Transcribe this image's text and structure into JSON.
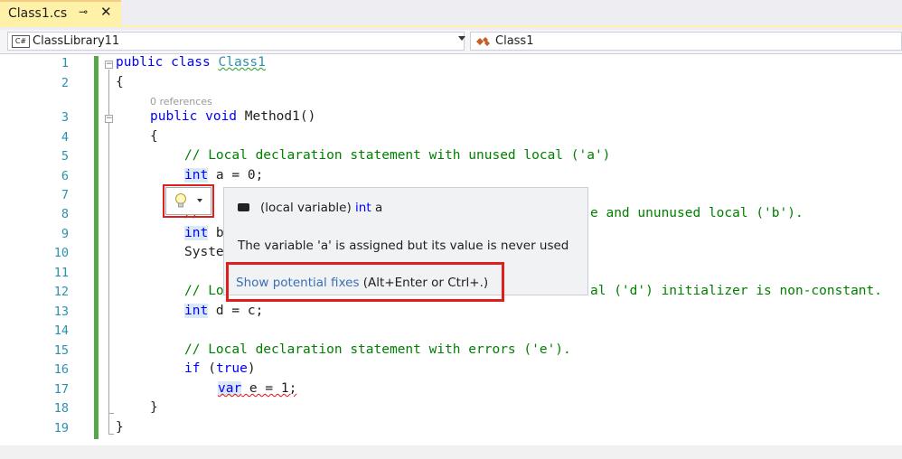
{
  "tab": {
    "title": "Class1.cs",
    "pin_glyph": "⊸",
    "close_glyph": "✕"
  },
  "navbar": {
    "project": "ClassLibrary11",
    "project_icon_text": "C#",
    "class_name": "Class1"
  },
  "gutter": {
    "line_numbers": [
      "1",
      "2",
      "3",
      "4",
      "5",
      "6",
      "7",
      "8",
      "9",
      "10",
      "11",
      "12",
      "13",
      "14",
      "15",
      "16",
      "17",
      "18",
      "19"
    ]
  },
  "codelens": {
    "references": "0 references"
  },
  "code": {
    "l1_kw": "public class ",
    "l1_name": "Class1",
    "l2": "{",
    "l3_kw": "public void ",
    "l3_rest": "Method1()",
    "l4": "{",
    "l5": "// Local declaration statement with unused local ('a')",
    "l6_type": "int",
    "l6_rest": " a = 0;",
    "l8_left": "//",
    "l8_right": "e and ununused local ('b').",
    "l9_type": "int",
    "l9_rest": " b",
    "l10": "Syste",
    "l12_left": "// Lo",
    "l12_right": "al ('d') initializer is non-constant.",
    "l13_type": "int",
    "l13_rest": " d = c;",
    "l15": "// Local declaration statement with errors ('e').",
    "l16_kw": "if",
    "l16_rest": " (",
    "l16_kw2": "true",
    "l16_end": ")",
    "l17_kw": "var",
    "l17_rest": " e = 1;",
    "l18": "}",
    "l19": "}"
  },
  "tooltip": {
    "signature_prefix": "(local variable) ",
    "signature_type": "int",
    "signature_name": " a",
    "message": "The variable 'a' is assigned but its value is never used",
    "fix_link": "Show potential fixes",
    "fix_shortcut": " (Alt+Enter or Ctrl+.)"
  },
  "colors": {
    "keyword": "#0000ff",
    "type": "#2b91af",
    "comment": "#008000",
    "line_number": "#2b91af",
    "highlight_box": "#e01e1e",
    "change_bar": "#57a64a"
  }
}
